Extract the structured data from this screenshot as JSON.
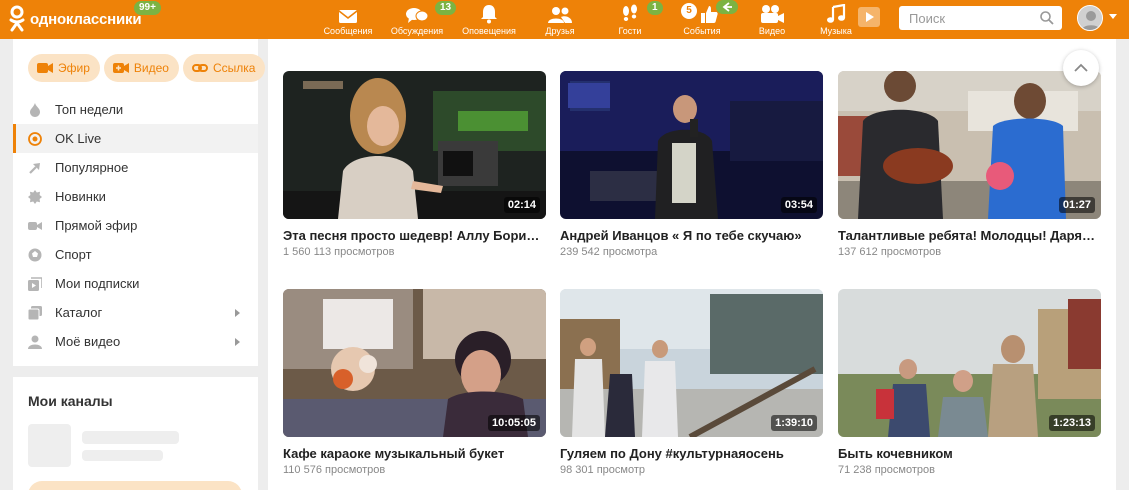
{
  "header": {
    "logo_text": "одноклассники",
    "logo_badge": "99+",
    "nav": [
      {
        "label": "Сообщения",
        "icon": "envelope-icon",
        "badge": ""
      },
      {
        "label": "Обсуждения",
        "icon": "chat-bubbles-icon",
        "badge": "13"
      },
      {
        "label": "Оповещения",
        "icon": "bell-icon",
        "badge": ""
      },
      {
        "label": "Друзья",
        "icon": "friends-icon",
        "badge": ""
      },
      {
        "label": "Гости",
        "icon": "footprints-icon",
        "badge": "1"
      },
      {
        "label": "События",
        "icon": "thumbs-up-icon",
        "badge": "5"
      },
      {
        "label": "Видео",
        "icon": "video-camera-icon",
        "badge": ""
      },
      {
        "label": "Музыка",
        "icon": "music-note-icon",
        "badge": ""
      }
    ],
    "search_placeholder": "Поиск",
    "accent_color": "#ee8208"
  },
  "sidebar": {
    "pills": [
      {
        "label": "Эфир",
        "icon": "live-camera-icon"
      },
      {
        "label": "Видео",
        "icon": "video-plus-icon"
      },
      {
        "label": "Ссылка",
        "icon": "link-icon"
      }
    ],
    "items": [
      {
        "label": "Топ недели",
        "icon": "flame-icon"
      },
      {
        "label": "OK Live",
        "icon": "ok-live-icon"
      },
      {
        "label": "Популярное",
        "icon": "trend-arrow-icon"
      },
      {
        "label": "Новинки",
        "icon": "new-badge-icon"
      },
      {
        "label": "Прямой эфир",
        "icon": "live-broadcast-icon"
      },
      {
        "label": "Спорт",
        "icon": "sport-ball-icon"
      },
      {
        "label": "Мои подписки",
        "icon": "subscriptions-icon"
      },
      {
        "label": "Каталог",
        "icon": "catalog-icon"
      },
      {
        "label": "Моё видео",
        "icon": "user-icon"
      }
    ],
    "channels_title": "Мои каналы"
  },
  "videos": [
    {
      "title": "Эта песня просто шедевр! Аллу Борисовну",
      "views": "1 560 113 просмотров",
      "duration": "02:14"
    },
    {
      "title": "Андрей Иванцов « Я по тебе скучаю»",
      "views": "239 542 просмотра",
      "duration": "03:54"
    },
    {
      "title": "Талантливые ребята! Молодцы! Дарят радость",
      "views": "137 612 просмотров",
      "duration": "01:27"
    },
    {
      "title": "Кафе караоке музыкальный букет",
      "views": "110 576 просмотров",
      "duration": "10:05:05"
    },
    {
      "title": "Гуляем по Дону #культурнаяосень",
      "views": "98 301 просмотр",
      "duration": "1:39:10"
    },
    {
      "title": "Быть кочевником",
      "views": "71 238 просмотров",
      "duration": "1:23:13"
    }
  ]
}
